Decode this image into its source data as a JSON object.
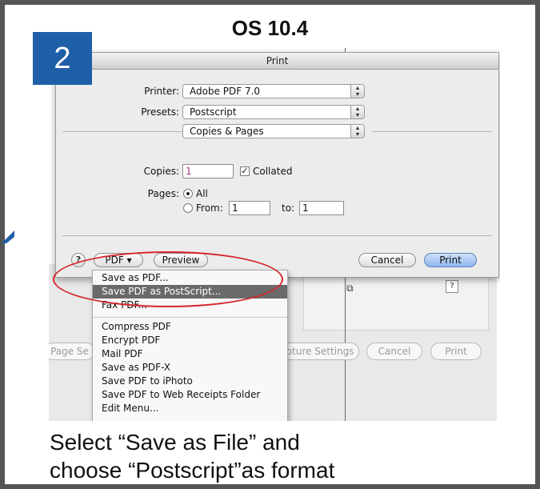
{
  "heading": "OS 10.4",
  "step_number": "2",
  "dialog": {
    "title": "Print",
    "printer_label": "Printer:",
    "printer_value": "Adobe PDF 7.0",
    "presets_label": "Presets:",
    "presets_value": "Postscript",
    "panel_value": "Copies & Pages",
    "copies_label": "Copies:",
    "copies_value": "1",
    "collated_label": "Collated",
    "pages_label": "Pages:",
    "pages_all": "All",
    "pages_from_label": "From:",
    "pages_from_value": "1",
    "pages_to_label": "to:",
    "pages_to_value": "1",
    "help_label": "?",
    "pdf_button": "PDF ▾",
    "preview_button": "Preview",
    "cancel_button": "Cancel",
    "print_button": "Print"
  },
  "pdf_menu": {
    "items": [
      "Save as PDF...",
      "Save PDF as PostScript...",
      "Fax PDF...",
      "Compress PDF",
      "Encrypt PDF",
      "Mail PDF",
      "Save as PDF-X",
      "Save PDF to iPhoto",
      "Save PDF to Web Receipts Folder",
      "Edit Menu..."
    ],
    "highlighted_index": 1
  },
  "background_dialog": {
    "page_setup_button": "Page Se",
    "capture_settings_button": "pture Settings",
    "cancel_button": "Cancel",
    "print_button": "Print",
    "help_label": "?",
    "copy_icon": "copy-icon"
  },
  "caption": {
    "line1": "Select “Save as File” and",
    "line2": "choose “Postscript”as format"
  },
  "colors": {
    "badge": "#1f5fa8",
    "frame": "#555555",
    "highlight_ring": "#d7262b",
    "menu_highlight": "#6a6a6a",
    "default_button": "#8fb6ee"
  }
}
